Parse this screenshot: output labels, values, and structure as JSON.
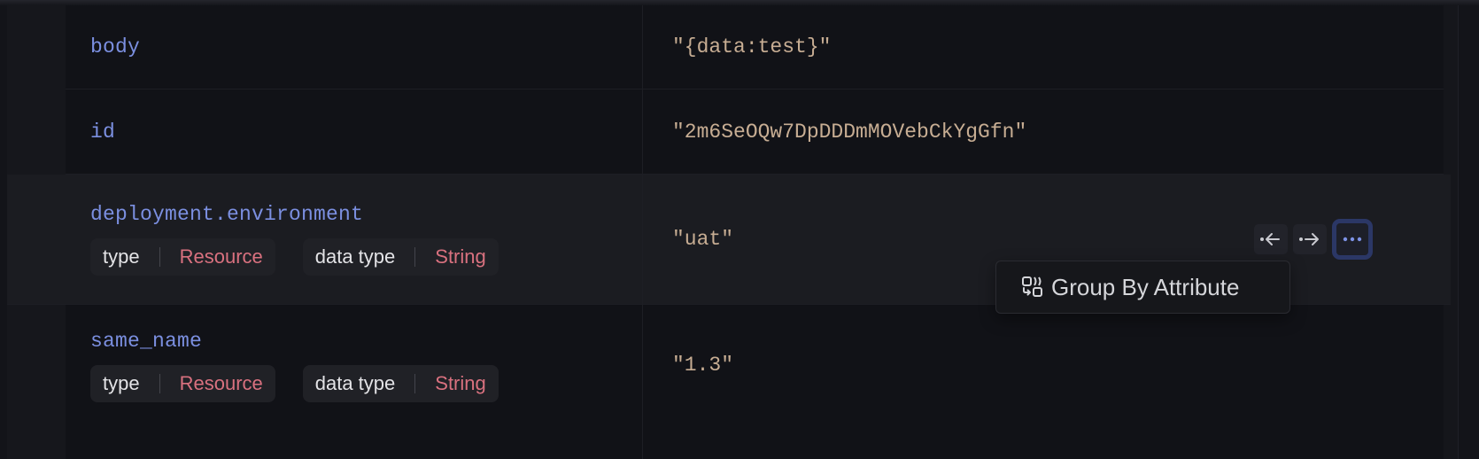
{
  "rows": [
    {
      "key": "body",
      "value": "\"{data:test}\""
    },
    {
      "key": "id",
      "value": "\"2m6SeOQw7DpDDDmMOVebCkYgGfn\""
    },
    {
      "key": "deployment.environment",
      "value": "\"uat\"",
      "tags": [
        {
          "label": "type",
          "value": "Resource"
        },
        {
          "label": "data type",
          "value": "String"
        }
      ]
    },
    {
      "key": "same_name",
      "value": "\"1.3\"",
      "tags": [
        {
          "label": "type",
          "value": "Resource"
        },
        {
          "label": "data type",
          "value": "String"
        }
      ]
    }
  ],
  "row_actions": {
    "filter_out_icon": "arrow-left-icon",
    "filter_in_icon": "arrow-right-icon",
    "more_icon": "more-horizontal-icon"
  },
  "context_menu": {
    "items": [
      {
        "label": "Group By Attribute",
        "icon": "group-by-icon"
      }
    ]
  },
  "colors": {
    "key": "#7b8fe0",
    "value": "#c7ad93",
    "tag_value": "#d9717f",
    "focus_ring": "#2b3766"
  }
}
